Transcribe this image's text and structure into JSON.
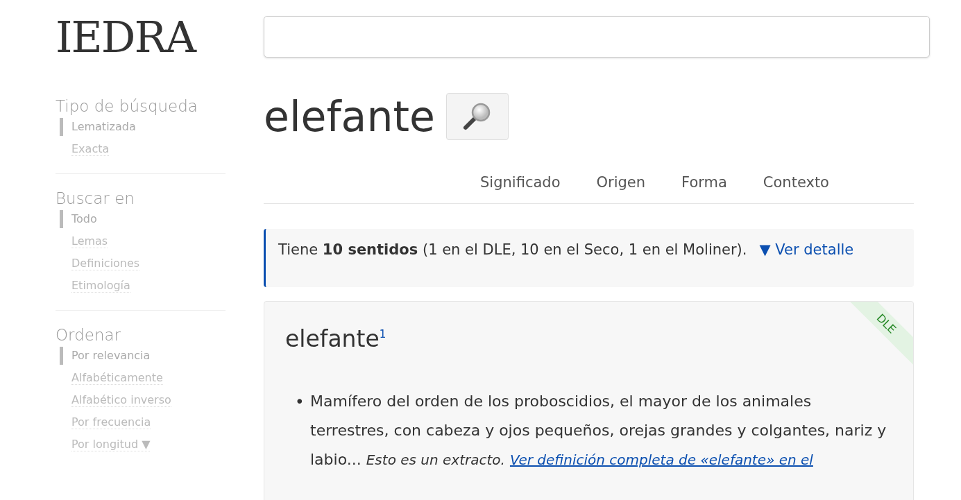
{
  "logo": "IEDRA",
  "sidebar": [
    {
      "title": "Tipo de búsqueda",
      "items": [
        {
          "label": "Lematizada",
          "selected": true
        },
        {
          "label": "Exacta",
          "selected": false
        }
      ]
    },
    {
      "title": "Buscar en",
      "items": [
        {
          "label": "Todo",
          "selected": true
        },
        {
          "label": "Lemas",
          "selected": false
        },
        {
          "label": "Definiciones",
          "selected": false
        },
        {
          "label": "Etimología",
          "selected": false
        }
      ]
    },
    {
      "title": "Ordenar",
      "items": [
        {
          "label": "Por relevancia",
          "selected": true
        },
        {
          "label": "Alfabéticamente",
          "selected": false
        },
        {
          "label": "Alfabético inverso",
          "selected": false
        },
        {
          "label": "Por frecuencia",
          "selected": false
        },
        {
          "label": "Por longitud ▼",
          "selected": false
        }
      ]
    }
  ],
  "word": "elefante",
  "tabs": [
    "Significado",
    "Origen",
    "Forma",
    "Contexto"
  ],
  "summary": {
    "text": "Tiene **10 sentidos** (1 en el DLE, 10 en el Seco, 1 en el Moliner).",
    "link": "▼ Ver detalle"
  },
  "entry": {
    "bullet": "•",
    "headword": "elefante",
    "index": "1",
    "source": "DLE",
    "definition": "Mamífero del orden de los proboscidios, el mayor de los animales terrestres, con cabeza y ojos pequeños, orejas grandes y colgantes, nariz y labio...",
    "note": "Esto es un extracto.",
    "link": "Ver definición completa de «elefante» en el"
  }
}
